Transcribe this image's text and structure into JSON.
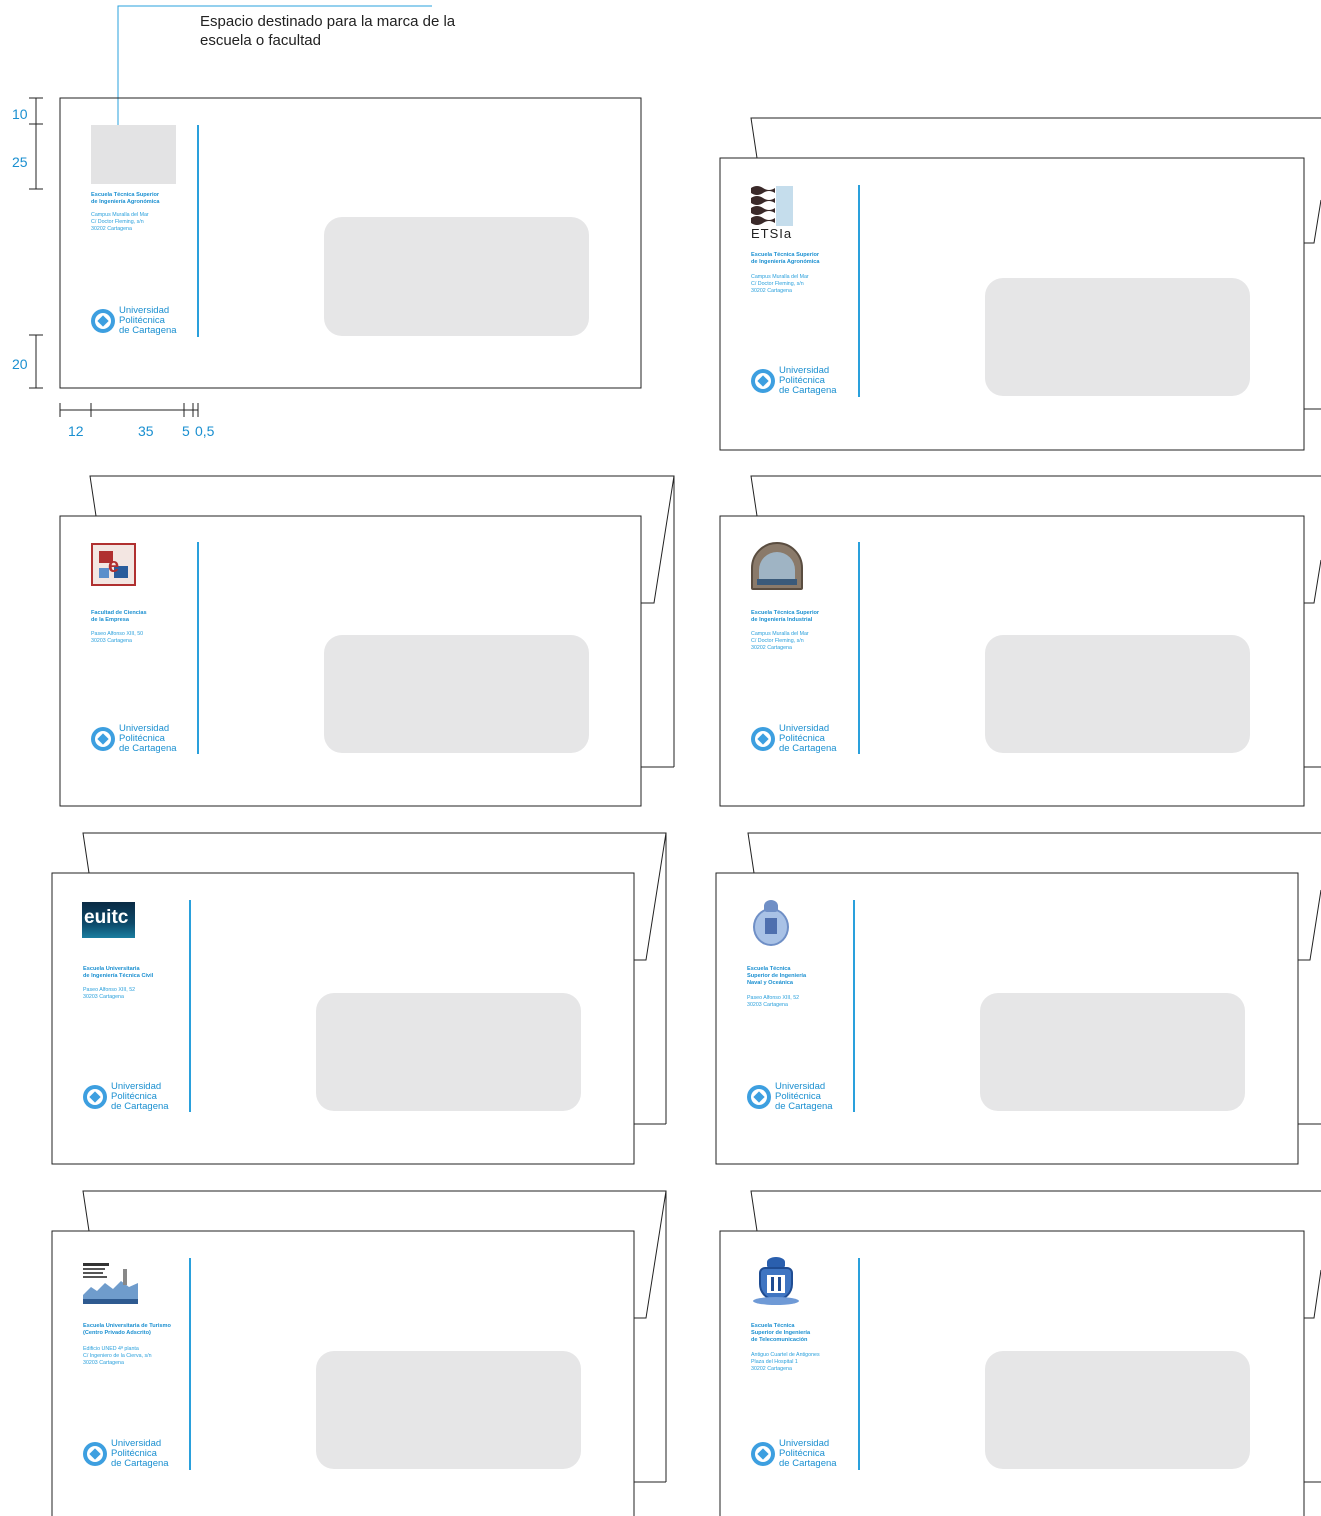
{
  "callout": {
    "text": "Espacio destinado para la marca de la escuela o facultad"
  },
  "dimensions": {
    "top_margin": "10",
    "brand_height": "25",
    "bottom_margin": "20",
    "left_margin": "12",
    "brand_width": "35",
    "gap": "5",
    "line_width": "0,5"
  },
  "upct": {
    "name": "Universidad\nPolitécnica\nde Cartagena"
  },
  "template_envelope": {
    "school_name": "Escuela Técnica Superior\nde Ingeniería Agronómica",
    "school_address": "Campus Muralla del Mar\nC/ Doctor Fleming, s/n\n30202 Cartagena"
  },
  "envelopes": [
    {
      "id": "etsia",
      "logo_text": "ETSIa",
      "school_name": "Escuela Técnica Superior\nde Ingeniería Agronómica",
      "school_address": "Campus Muralla del Mar\nC/ Doctor Fleming, s/n\n30202 Cartagena"
    },
    {
      "id": "empresa",
      "school_name": "Facultad de Ciencias\nde la Empresa",
      "school_address": "Paseo Alfonso XIII, 50\n30203 Cartagena"
    },
    {
      "id": "industrial",
      "school_name": "Escuela Técnica Superior\nde Ingeniería Industrial",
      "school_address": "Campus Muralla del Mar\nC/ Doctor Fleming, s/n\n30202 Cartagena"
    },
    {
      "id": "euitc",
      "logo_text": "euitc",
      "school_name": "Escuela Universitaria\nde Ingeniería Técnica Civil",
      "school_address": "Paseo Alfonso XIII, 52\n30203 Cartagena"
    },
    {
      "id": "naval",
      "school_name": "Escuela Técnica\nSuperior de Ingeniería\nNaval y Oceánica",
      "school_address": "Paseo Alfonso XIII, 52\n30203 Cartagena"
    },
    {
      "id": "turismo",
      "school_name": "Escuela Universitaria de Turismo\n(Centro Privado Adscrito)",
      "school_address": "Edificio UNED 4ª planta\nC/ Ingeniero de la Cierva, s/n\n30203 Cartagena"
    },
    {
      "id": "telecom",
      "school_name": "Escuela Técnica\nSuperior de Ingeniería\nde Telecomunicación",
      "school_address": "Antiguo Cuartel de Antigones\nPlaza del Hospital 1\n30202 Cartagena"
    }
  ],
  "colors": {
    "accent": "#1a8fd0",
    "line": "#2aa0dc",
    "window": "#e6e6e7",
    "outline": "#222222"
  }
}
